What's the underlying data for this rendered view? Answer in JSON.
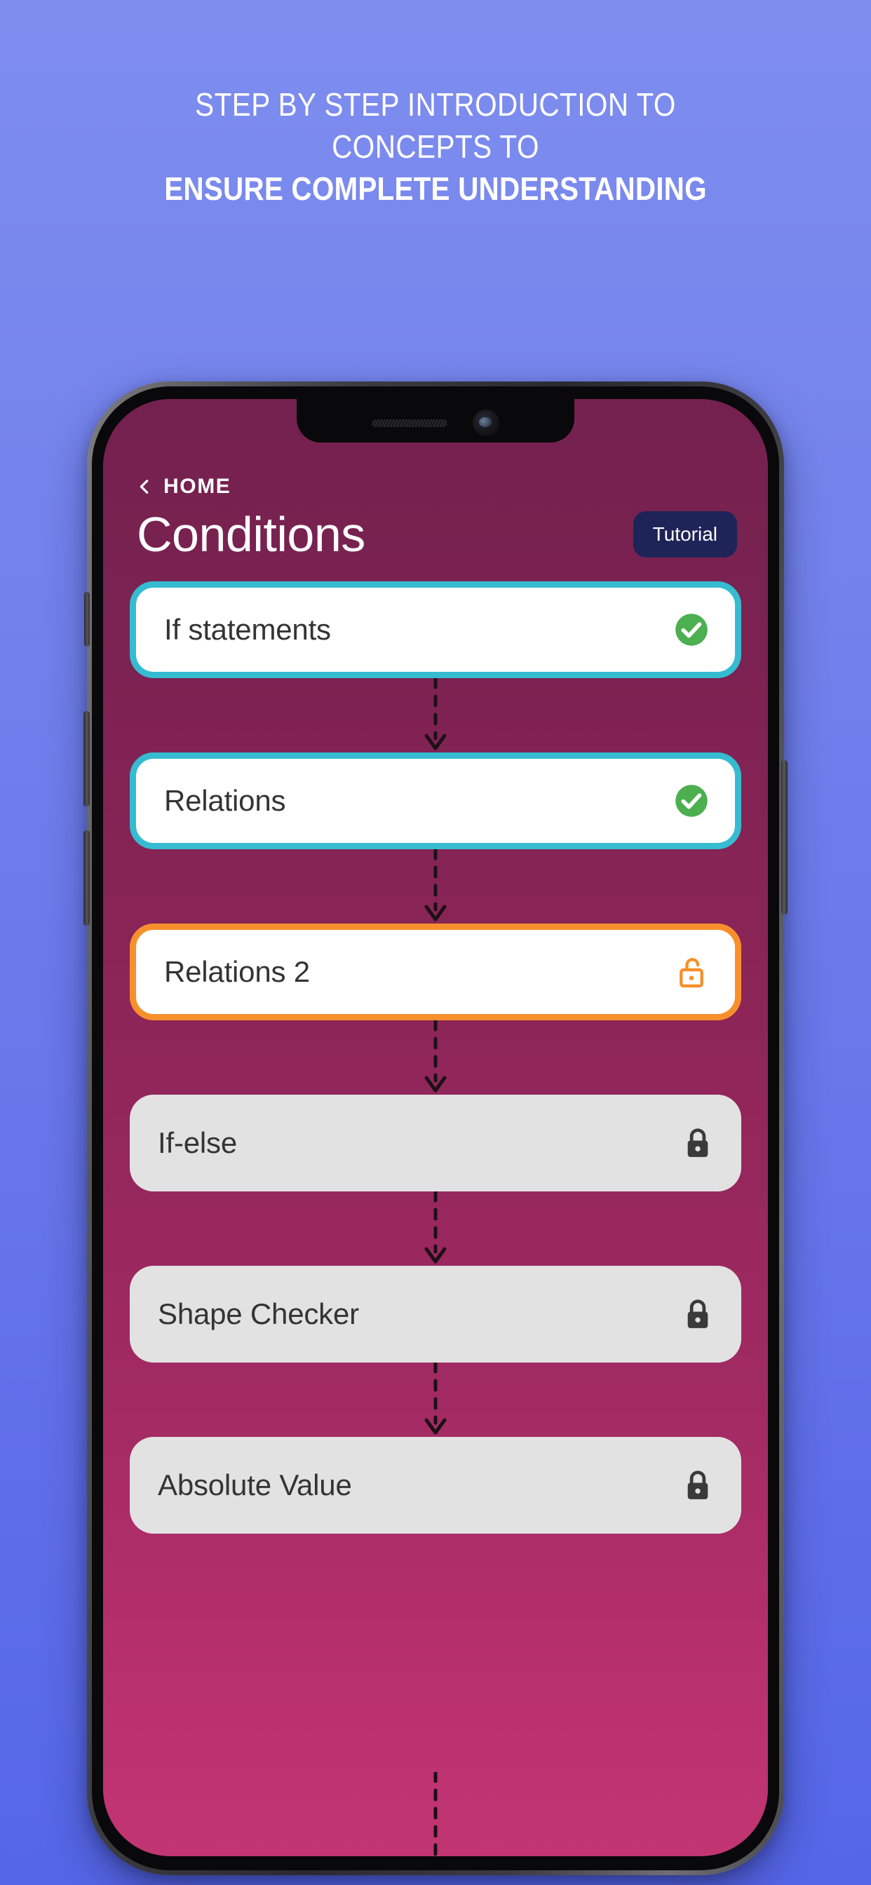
{
  "promo": {
    "line1": "STEP BY STEP INTRODUCTION TO",
    "line2": "CONCEPTS TO",
    "line3": "ENSURE COMPLETE UNDERSTANDING"
  },
  "colors": {
    "background_top": "#7e8dee",
    "background_bottom": "#5566e8",
    "screen_top": "#74214f",
    "screen_bottom": "#c23573",
    "accent_teal": "#35bcd0",
    "accent_orange": "#f7902c",
    "accent_green": "#4caf50",
    "tutorial_button": "#1e2457",
    "card_locked": "#e2e2e2",
    "card_open": "#ffffff"
  },
  "app": {
    "back_nav": {
      "label": "HOME",
      "icon": "chevron-left-icon"
    },
    "title": "Conditions",
    "tutorial_button": {
      "label": "Tutorial"
    },
    "lessons": [
      {
        "label": "If statements",
        "state": "done",
        "icon": "check-circle-icon"
      },
      {
        "label": "Relations",
        "state": "done",
        "icon": "check-circle-icon"
      },
      {
        "label": "Relations 2",
        "state": "unlocked",
        "icon": "unlock-icon"
      },
      {
        "label": "If-else",
        "state": "locked",
        "icon": "lock-icon"
      },
      {
        "label": "Shape Checker",
        "state": "locked",
        "icon": "lock-icon"
      },
      {
        "label": "Absolute Value",
        "state": "locked",
        "icon": "lock-icon"
      }
    ]
  },
  "device": {
    "notch": {
      "speaker": "speaker-grille",
      "camera": "front-camera"
    },
    "buttons": [
      "silent-switch",
      "volume-down-button",
      "volume-up-button",
      "power-button"
    ]
  }
}
